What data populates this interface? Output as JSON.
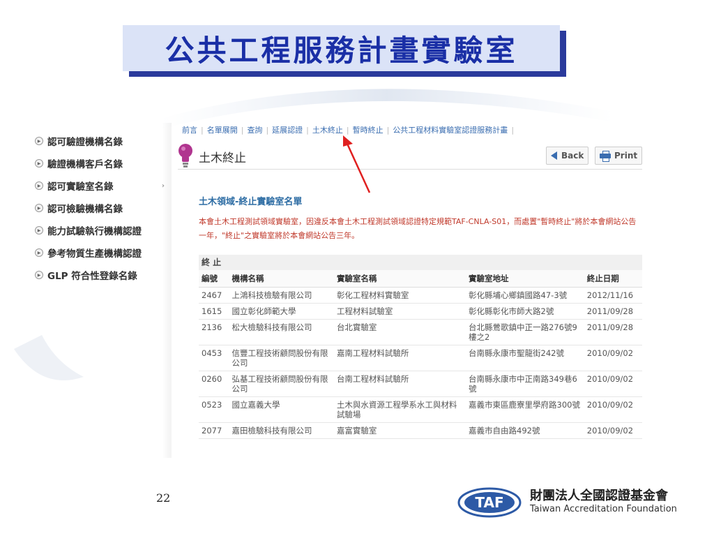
{
  "slide": {
    "title": "公共工程服務計畫實驗室",
    "page_number": "22"
  },
  "sidebar": {
    "items": [
      {
        "label": "認可驗證機構名錄"
      },
      {
        "label": "驗證機構客戶名錄"
      },
      {
        "label": "認可實驗室名錄",
        "more": "›"
      },
      {
        "label": "認可檢驗機構名錄"
      },
      {
        "label": "能力試驗執行機構認證"
      },
      {
        "label": "參考物質生產機構認證"
      },
      {
        "label": "GLP 符合性登錄名錄"
      }
    ]
  },
  "topnav": {
    "links": [
      "前言",
      "名單展開",
      "查詢",
      "延展認證",
      "土木終止",
      "暫時終止",
      "公共工程材料實驗室認證服務計畫"
    ]
  },
  "header": {
    "section_title": "土木終止",
    "back_label": "Back",
    "print_label": "Print"
  },
  "content": {
    "sub_title": "土木領域-終止實驗室名單",
    "notice": "本會土木工程測試領域實驗室，因違反本會土木工程測試領域認證特定規範TAF-CNLA-S01，而處置\"暫時終止\"將於本會網站公告一年，\"終止\"之實驗室將於本會網站公告三年。"
  },
  "table": {
    "caption": "終 止",
    "headers": [
      "編號",
      "機構名稱",
      "實驗室名稱",
      "實驗室地址",
      "終止日期"
    ],
    "rows": [
      [
        "2467",
        "上鴻科技檢驗有限公司",
        "彰化工程材料實驗室",
        "彰化縣埔心鄉鎮國路47-3號",
        "2012/11/16"
      ],
      [
        "1615",
        "國立彰化師範大學",
        "工程材料試驗室",
        "彰化縣彰化市師大路2號",
        "2011/09/28"
      ],
      [
        "2136",
        "松大檢驗科技有限公司",
        "台北實驗室",
        "台北縣鶯歌鎮中正一路276號9樓之2",
        "2011/09/28"
      ],
      [
        "0453",
        "信豐工程技術顧問股份有限公司",
        "嘉南工程材料試驗所",
        "台南縣永康市聖龍街242號",
        "2010/09/02"
      ],
      [
        "0260",
        "弘基工程技術顧問股份有限公司",
        "台南工程材料試驗所",
        "台南縣永康市中正南路349巷6號",
        "2010/09/02"
      ],
      [
        "0523",
        "國立嘉義大學",
        "土木與水資源工程學系水工與材料試驗場",
        "嘉義市東區鹿寮里學府路300號",
        "2010/09/02"
      ],
      [
        "2077",
        "嘉田檢驗科技有限公司",
        "嘉富實驗室",
        "嘉義市自由路492號",
        "2010/09/02"
      ]
    ]
  },
  "logo": {
    "mark": "TAF",
    "name_cn": "財團法人全國認證基金會",
    "name_en": "Taiwan Accreditation Foundation"
  },
  "colors": {
    "title_blue": "#1a2fa6",
    "link_blue": "#3a6db0",
    "alert_red": "#c0392b",
    "arrow_red": "#e02020"
  }
}
